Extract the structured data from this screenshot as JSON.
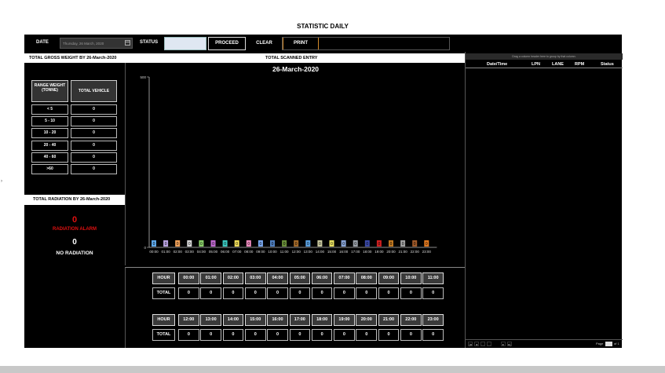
{
  "page": {
    "title": "STATISTIC DAILY"
  },
  "topbar": {
    "date_label": "DATE",
    "date_value": "Thursday, 26 March, 2020",
    "status_label": "STATUS",
    "status_value": "",
    "proceed_label": "PROCEED",
    "clear_label": "CLEAR",
    "print_label": "PRINT"
  },
  "strip": {
    "gross_weight_title": "TOTAL GROSS WEIGHT BY 26-March-2020",
    "scanned_title": "TOTAL SCANNED ENTRY"
  },
  "weight_table": {
    "headers": [
      "RANGE WEIGHT (TONNE)",
      "TOTAL VEHICLE"
    ],
    "rows": [
      {
        "range": "< 5",
        "total": "0"
      },
      {
        "range": "5 - 10",
        "total": "0"
      },
      {
        "range": "10 - 20",
        "total": "0"
      },
      {
        "range": "20 - 40",
        "total": "0"
      },
      {
        "range": "40 - 60",
        "total": "0"
      },
      {
        "range": ">60",
        "total": "0"
      }
    ]
  },
  "radiation": {
    "title": "TOTAL RADIATION BY 26-March-2020",
    "alarm_count": "0",
    "alarm_label": "RADIATION ALARM",
    "no_count": "0",
    "no_label": "NO RADIATION"
  },
  "chart_data": {
    "type": "bar",
    "title": "26-March-2020",
    "xlabel": "",
    "ylabel": "",
    "ylim": [
      0,
      500
    ],
    "y_tick_labels": [
      "0",
      "500"
    ],
    "categories": [
      "00:00",
      "01:00",
      "02:00",
      "03:00",
      "04:00",
      "05:00",
      "06:00",
      "07:00",
      "08:00",
      "09:00",
      "10:00",
      "11:00",
      "12:00",
      "13:00",
      "14:00",
      "15:00",
      "16:00",
      "17:00",
      "18:00",
      "19:00",
      "20:00",
      "21:00",
      "22:00",
      "23:00"
    ],
    "values": [
      0,
      0,
      0,
      0,
      0,
      0,
      0,
      0,
      0,
      0,
      0,
      0,
      0,
      0,
      0,
      0,
      0,
      0,
      0,
      0,
      0,
      0,
      0,
      0
    ],
    "data_labels": [
      "0",
      "0",
      "0",
      "0",
      "0",
      "0",
      "0",
      "0",
      "0",
      "0",
      "0",
      "0",
      "0",
      "0",
      "0",
      "0",
      "0",
      "0",
      "0",
      "0",
      "0",
      "0",
      "0",
      "0"
    ],
    "bar_colors": [
      "#5fa8e8",
      "#b9a3e0",
      "#f2a35a",
      "#d9d9d9",
      "#8ad06a",
      "#c06ad0",
      "#3cc8c0",
      "#f2de5a",
      "#f08cc0",
      "#7aa8f0",
      "#4f7fc0",
      "#6a8f3a",
      "#a36a2a",
      "#5aa0e0",
      "#c9c9a0",
      "#e8e060",
      "#8aa6d8",
      "#9aa0a8",
      "#3b4aa8",
      "#d02020",
      "#c07820",
      "#a0a0a0",
      "#a05a2a",
      "#e07820"
    ],
    "grid": false
  },
  "hours": {
    "hour_label": "HOUR",
    "total_label": "TOTAL",
    "row1": [
      "00:00",
      "01:00",
      "02:00",
      "03:00",
      "04:00",
      "05:00",
      "06:00",
      "07:00",
      "08:00",
      "09:00",
      "10:00",
      "11:00"
    ],
    "row1_totals": [
      "0",
      "0",
      "0",
      "0",
      "0",
      "0",
      "0",
      "0",
      "0",
      "0",
      "0",
      "0"
    ],
    "row2": [
      "12:00",
      "13:00",
      "14:00",
      "15:00",
      "16:00",
      "17:00",
      "18:00",
      "19:00",
      "20:00",
      "21:00",
      "22:00",
      "23:00"
    ],
    "row2_totals": [
      "0",
      "0",
      "0",
      "0",
      "0",
      "0",
      "0",
      "0",
      "0",
      "0",
      "0",
      "0"
    ]
  },
  "right_grid": {
    "group_hint": "Drag a column header here to group by that column.",
    "columns": [
      "Date/Time",
      "LPN",
      "LANE",
      "RPM",
      "Status"
    ],
    "pager": {
      "page_label": "Page",
      "of_label": "of 1"
    }
  }
}
